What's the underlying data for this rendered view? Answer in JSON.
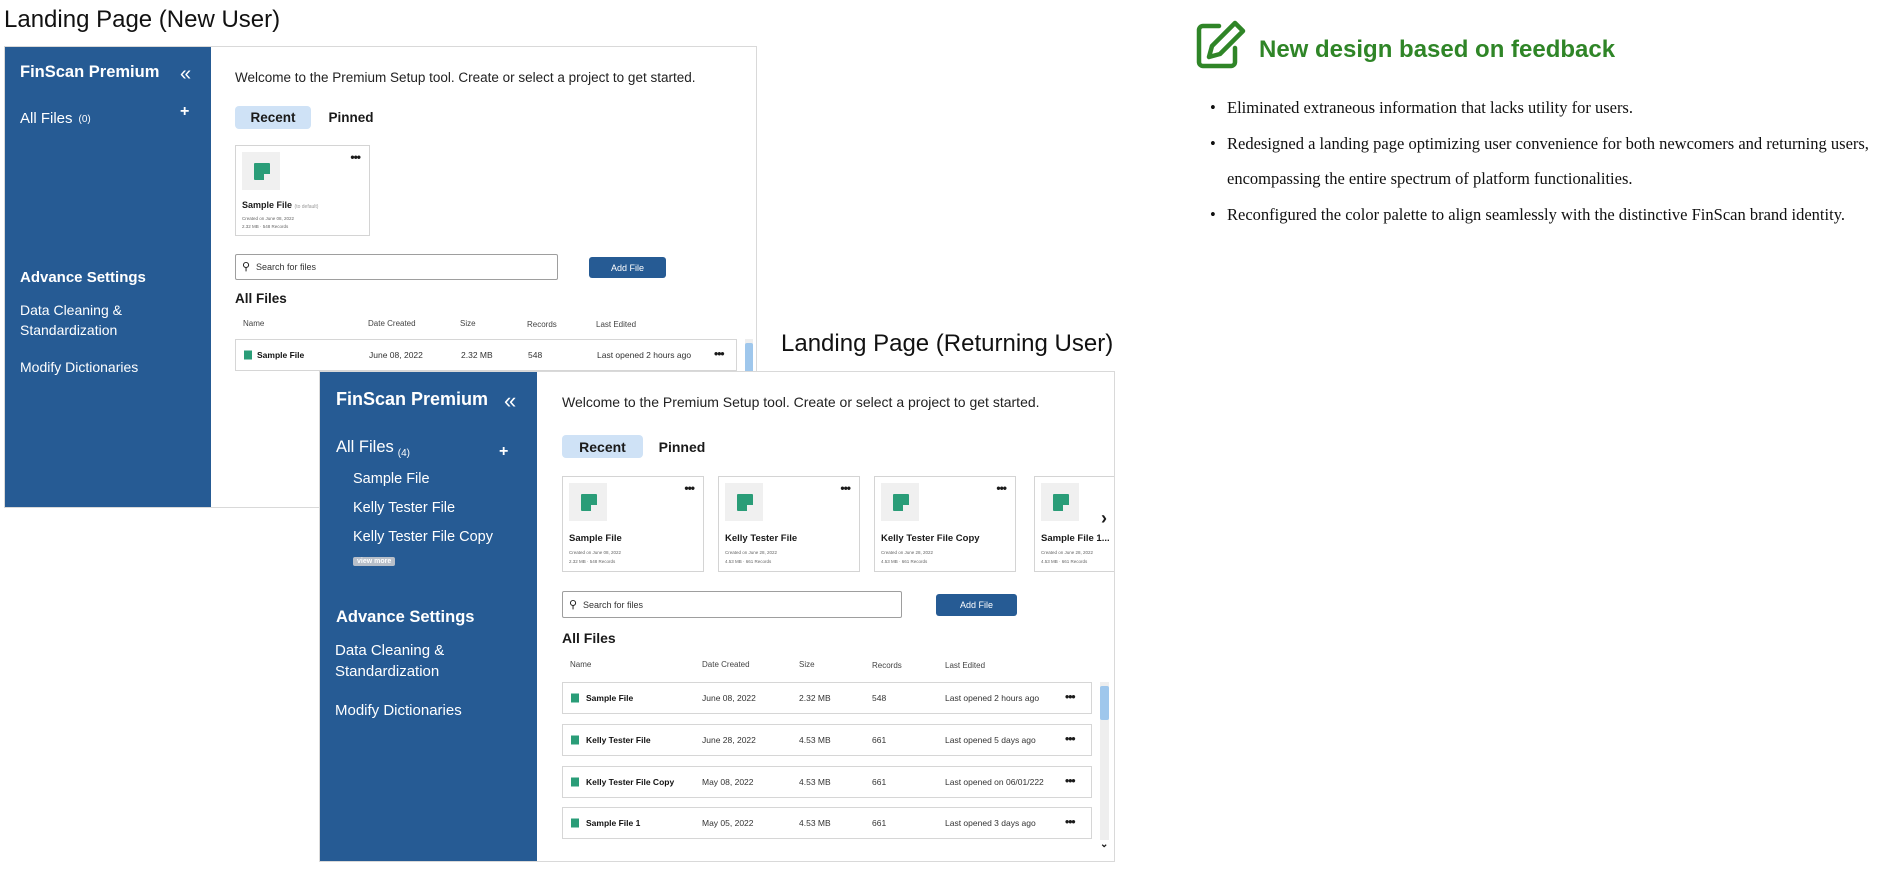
{
  "new_user": {
    "title": "Landing Page (New User)",
    "sidebar": {
      "brand": "FinScan Premium",
      "collapse_icon": "double-chevron-left-icon",
      "all_files_label": "All Files",
      "all_files_count": "(0)",
      "add_label": "+",
      "advance_settings": "Advance Settings",
      "data_cleaning_line1": "Data Cleaning &",
      "data_cleaning_line2": "Standardization",
      "modify_dictionaries": "Modify Dictionaries"
    },
    "welcome": "Welcome to the Premium Setup tool. Create or select a project to get started.",
    "tabs": [
      "Recent",
      "Pinned"
    ],
    "cards": [
      {
        "name": "Sample File",
        "tag": "(to default)",
        "created": "Created on June 08, 2022",
        "meta": "2.32 MB · 548 Records"
      }
    ],
    "search_placeholder": "Search for files",
    "add_file": "Add File",
    "all_files_heading": "All Files",
    "columns": [
      "Name",
      "Date Created",
      "Size",
      "Records",
      "Last Edited"
    ],
    "rows": [
      {
        "name": "Sample File",
        "date": "June 08, 2022",
        "size": "2.32 MB",
        "records": "548",
        "edited": "Last opened 2 hours ago"
      }
    ]
  },
  "returning_user": {
    "title": "Landing Page (Returning  User)",
    "sidebar": {
      "brand": "FinScan Premium",
      "all_files_label": "All Files",
      "all_files_count": "(4)",
      "add_label": "+",
      "files": [
        "Sample File",
        "Kelly Tester File",
        "Kelly Tester File Copy"
      ],
      "view_more": "view more",
      "advance_settings": "Advance Settings",
      "data_cleaning_line1": "Data Cleaning &",
      "data_cleaning_line2": "Standardization",
      "modify_dictionaries": "Modify Dictionaries"
    },
    "welcome": "Welcome to the Premium Setup tool. Create or select a project to get started.",
    "tabs": [
      "Recent",
      "Pinned"
    ],
    "cards": [
      {
        "name": "Sample File",
        "created": "Created on June 08, 2022",
        "meta": "2.32 MB · 548 Records"
      },
      {
        "name": "Kelly Tester File",
        "created": "Created on June 28, 2022",
        "meta": "4.53 MB · 661 Records"
      },
      {
        "name": "Kelly Tester File Copy",
        "created": "Created on June 28, 2022",
        "meta": "4.53 MB · 661 Records"
      },
      {
        "name": "Sample File 1...",
        "created": "Created on June 28, 2022",
        "meta": "4.53 MB · 661 Records"
      }
    ],
    "search_placeholder": "Search for files",
    "add_file": "Add File",
    "all_files_heading": "All Files",
    "columns": [
      "Name",
      "Date Created",
      "Size",
      "Records",
      "Last Edited"
    ],
    "rows": [
      {
        "name": "Sample File",
        "date": "June 08, 2022",
        "size": "2.32 MB",
        "records": "548",
        "edited": "Last opened 2 hours ago"
      },
      {
        "name": "Kelly Tester File",
        "date": "June 28, 2022",
        "size": "4.53 MB",
        "records": "661",
        "edited": "Last opened 5 days ago"
      },
      {
        "name": "Kelly Tester File Copy",
        "date": "May 08, 2022",
        "size": "4.53 MB",
        "records": "661",
        "edited": "Last opened on 06/01/222"
      },
      {
        "name": "Sample File 1",
        "date": "May 05, 2022",
        "size": "4.53 MB",
        "records": "661",
        "edited": "Last opened 3 days ago"
      }
    ]
  },
  "feedback": {
    "title": "New design based on feedback",
    "icon": "pencil-edit-icon",
    "color": "#2f8527",
    "bullets": [
      "Eliminated extraneous information that lacks utility for users.",
      "Redesigned a landing page optimizing user convenience for both newcomers and returning users, encompassing the entire spectrum of platform functionalities.",
      "Reconfigured the color palette to align seamlessly with the distinctive FinScan brand identity."
    ]
  },
  "colors": {
    "sidebar": "#265b94",
    "accent_tab": "#cfe2f6",
    "file_icon": "#2a9d78"
  }
}
